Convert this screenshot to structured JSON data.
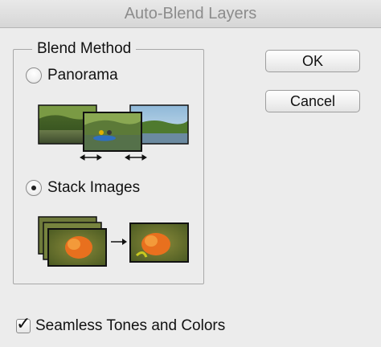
{
  "window": {
    "title": "Auto-Blend Layers"
  },
  "blend_method": {
    "legend": "Blend Method",
    "options": [
      {
        "label": "Panorama",
        "selected": false,
        "illustration": "panorama-illustration"
      },
      {
        "label": "Stack Images",
        "selected": true,
        "illustration": "stack-images-illustration"
      }
    ]
  },
  "buttons": {
    "ok": "OK",
    "cancel": "Cancel"
  },
  "seamless": {
    "label": "Seamless Tones and Colors",
    "checked": true
  },
  "icons": {
    "checkmark": "✓",
    "arrow_left_right": "↔",
    "arrow_right": "→"
  },
  "colors": {
    "dialog_bg": "#ececec",
    "title_text": "#8c8c8c",
    "group_border": "#a8a8a8"
  }
}
